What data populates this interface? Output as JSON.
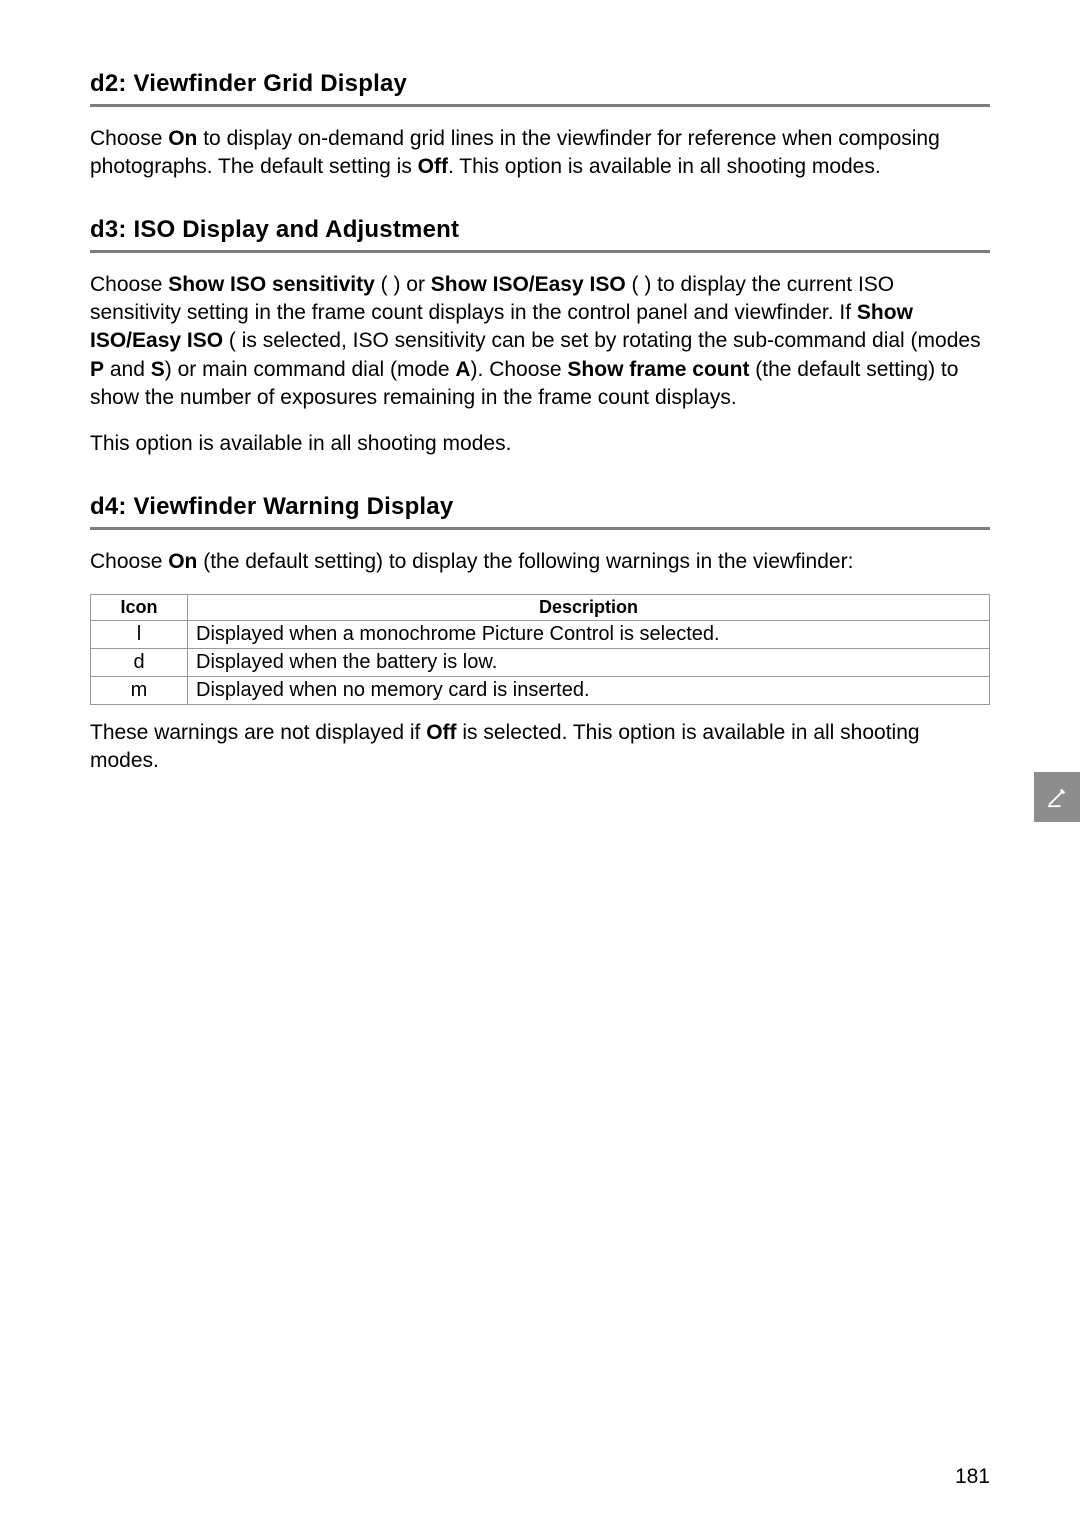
{
  "d2": {
    "heading": "d2: Viewfinder Grid Display",
    "para_parts": [
      "Choose ",
      "On",
      " to display on-demand grid lines in the viewfinder for reference when composing photographs.  The default setting is ",
      "Off",
      ".  This option is available in all shooting modes."
    ]
  },
  "d3": {
    "heading": "d3: ISO Display and Adjustment",
    "para1_parts": [
      "Choose ",
      "Show ISO sensitivity",
      " (       ) or ",
      "Show ISO/Easy ISO",
      " (        ) to display the current ISO sensitivity setting in the frame count displays in the control panel and viewfinder.  If ",
      "Show ISO/Easy ISO",
      " (          is selected, ISO sensitivity can be set by rotating the sub-command dial (modes ",
      "P",
      " and ",
      "S",
      ") or main command dial (mode ",
      "A",
      "). Choose ",
      "Show frame count",
      " (the default setting) to show the number of exposures remaining in the frame count displays."
    ],
    "para2": "This option is available in all shooting modes."
  },
  "d4": {
    "heading": "d4: Viewfinder Warning Display",
    "intro_parts": [
      "Choose ",
      "On",
      " (the default setting) to display the following warnings in the viewfinder:"
    ],
    "table": {
      "head_icon": "Icon",
      "head_desc": "Description",
      "rows": [
        {
          "icon": "l",
          "desc": "Displayed when a monochrome Picture Control is selected."
        },
        {
          "icon": "d",
          "desc": "Displayed when the battery is low."
        },
        {
          "icon": "m",
          "desc": "Displayed when no memory card is inserted."
        }
      ]
    },
    "outro_parts": [
      "These warnings are not displayed if ",
      "Off",
      " is selected.  This option is available in all shooting modes."
    ]
  },
  "page_number": "181"
}
